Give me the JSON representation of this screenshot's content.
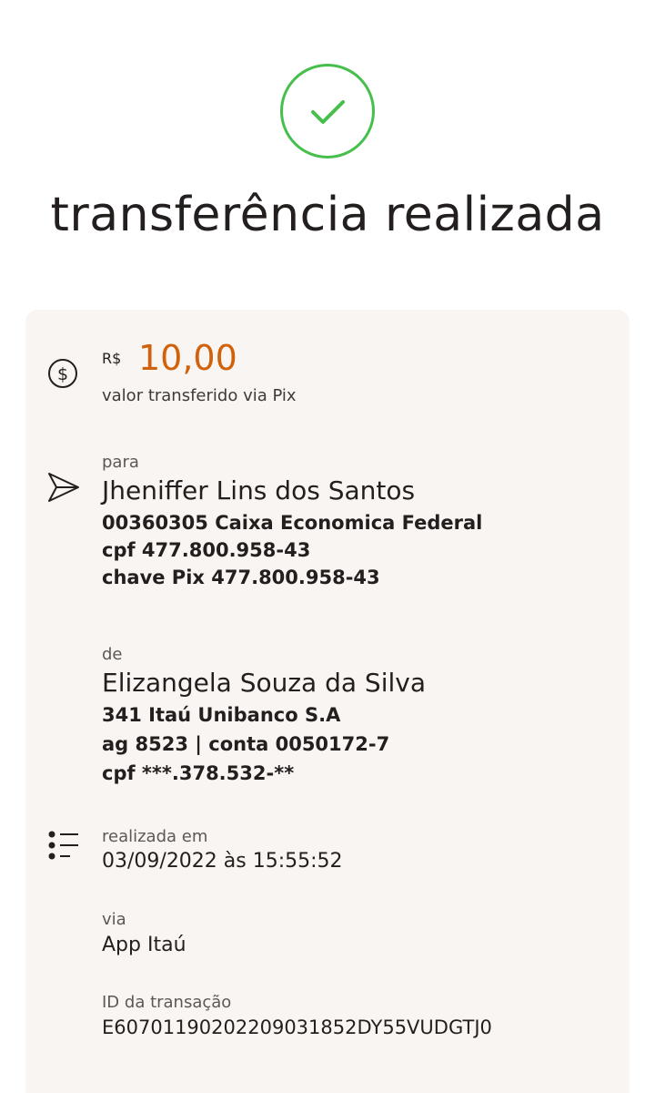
{
  "header": {
    "status_icon": "check-icon",
    "title": "transferência realizada",
    "accent_color": "#47bf4c"
  },
  "amount": {
    "icon": "dollar-circle-icon",
    "currency": "R$",
    "value": "10,00",
    "caption": "valor transferido via Pix",
    "color": "#d2610c"
  },
  "recipient": {
    "icon": "send-icon",
    "label": "para",
    "name": "Jheniffer Lins dos Santos",
    "bank": "00360305 Caixa Economica Federal",
    "cpf": "cpf 477.800.958-43",
    "pix_key": "chave Pix 477.800.958-43"
  },
  "sender": {
    "label": "de",
    "name": "Elizangela Souza da Silva",
    "bank": "341 Itaú Unibanco S.A",
    "account": "ag 8523 | conta 0050172-7",
    "cpf": "cpf ***.378.532-**"
  },
  "details": {
    "icon": "list-icon",
    "date_label": "realizada em",
    "date_value": "03/09/2022 às 15:55:52",
    "via_label": "via",
    "via_value": "App Itaú",
    "id_label": "ID da transação",
    "id_value": "E60701190202209031852DY55VUDGTJ0"
  }
}
